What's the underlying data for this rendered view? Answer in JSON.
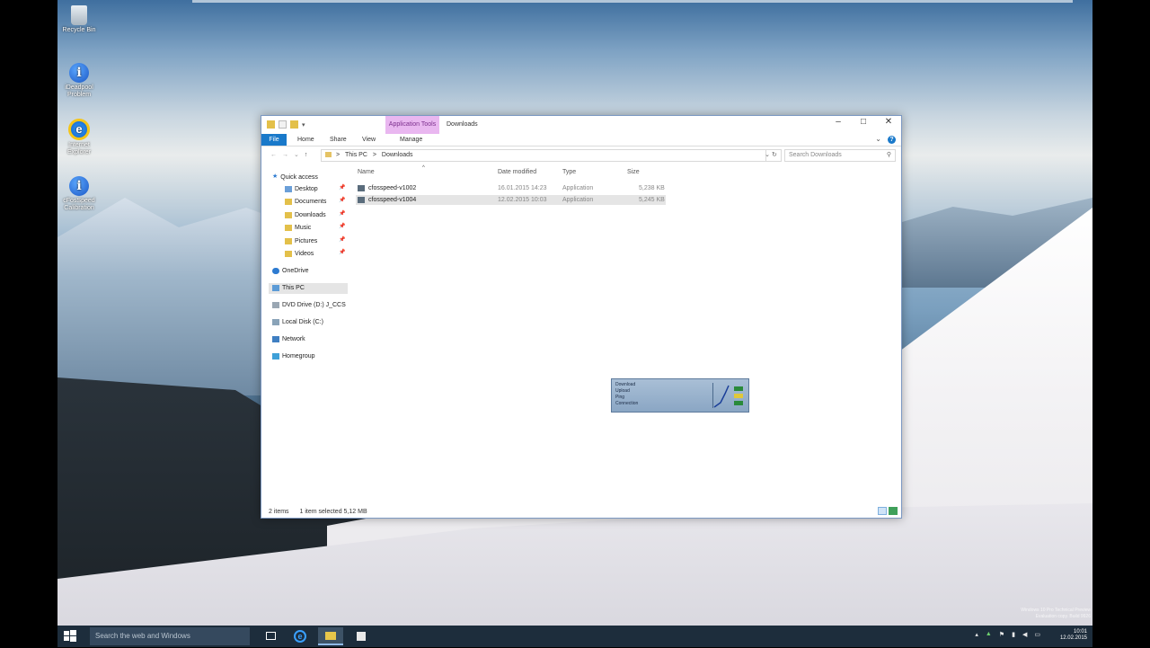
{
  "desktop": {
    "icons": [
      {
        "label": "Recycle Bin",
        "glyph": "recycle-bin-icon"
      },
      {
        "label": "iDeadpool Problem",
        "glyph": "i-info-icon"
      },
      {
        "label": "Internet Explorer",
        "glyph": "ie-icon"
      },
      {
        "label": "cFosSpeed Calibration",
        "glyph": "i-info-icon"
      }
    ],
    "watermark": [
      "Windows 10 Pro Technical Preview",
      "Evaluation copy. Build 9926"
    ]
  },
  "explorer": {
    "context_tab": "Application Tools",
    "title": "Downloads",
    "ribbon_tabs": [
      "File",
      "Home",
      "Share",
      "View",
      "Manage"
    ],
    "address": {
      "segments": [
        "This PC",
        "Downloads"
      ],
      "separator": ">"
    },
    "search_placeholder": "Search Downloads",
    "nav": {
      "quick_access": "Quick access",
      "quick_items": [
        "Desktop",
        "Documents",
        "Downloads",
        "Music",
        "Pictures",
        "Videos"
      ],
      "onedrive": "OneDrive",
      "this_pc": "This PC",
      "dvd": "DVD Drive (D:) J_CCS",
      "local_disk": "Local Disk (C:)",
      "network": "Network",
      "homegroup": "Homegroup"
    },
    "columns": {
      "name": "Name",
      "date": "Date modified",
      "type": "Type",
      "size": "Size"
    },
    "files": [
      {
        "name": "cfosspeed-v1002",
        "date": "16.01.2015 14:23",
        "type": "Application",
        "size": "5,238 KB"
      },
      {
        "name": "cfosspeed-v1004",
        "date": "12.02.2015 10:03",
        "type": "Application",
        "size": "5,245 KB"
      }
    ],
    "status": {
      "items": "2 items",
      "selected": "1 item selected  5,12 MB"
    }
  },
  "widget": {
    "rows": [
      "Download",
      "Upload",
      "Ping",
      "Connection"
    ]
  },
  "taskbar": {
    "search_placeholder": "Search the web and Windows",
    "clock_time": "10:01",
    "clock_date": "12.02.2015"
  }
}
